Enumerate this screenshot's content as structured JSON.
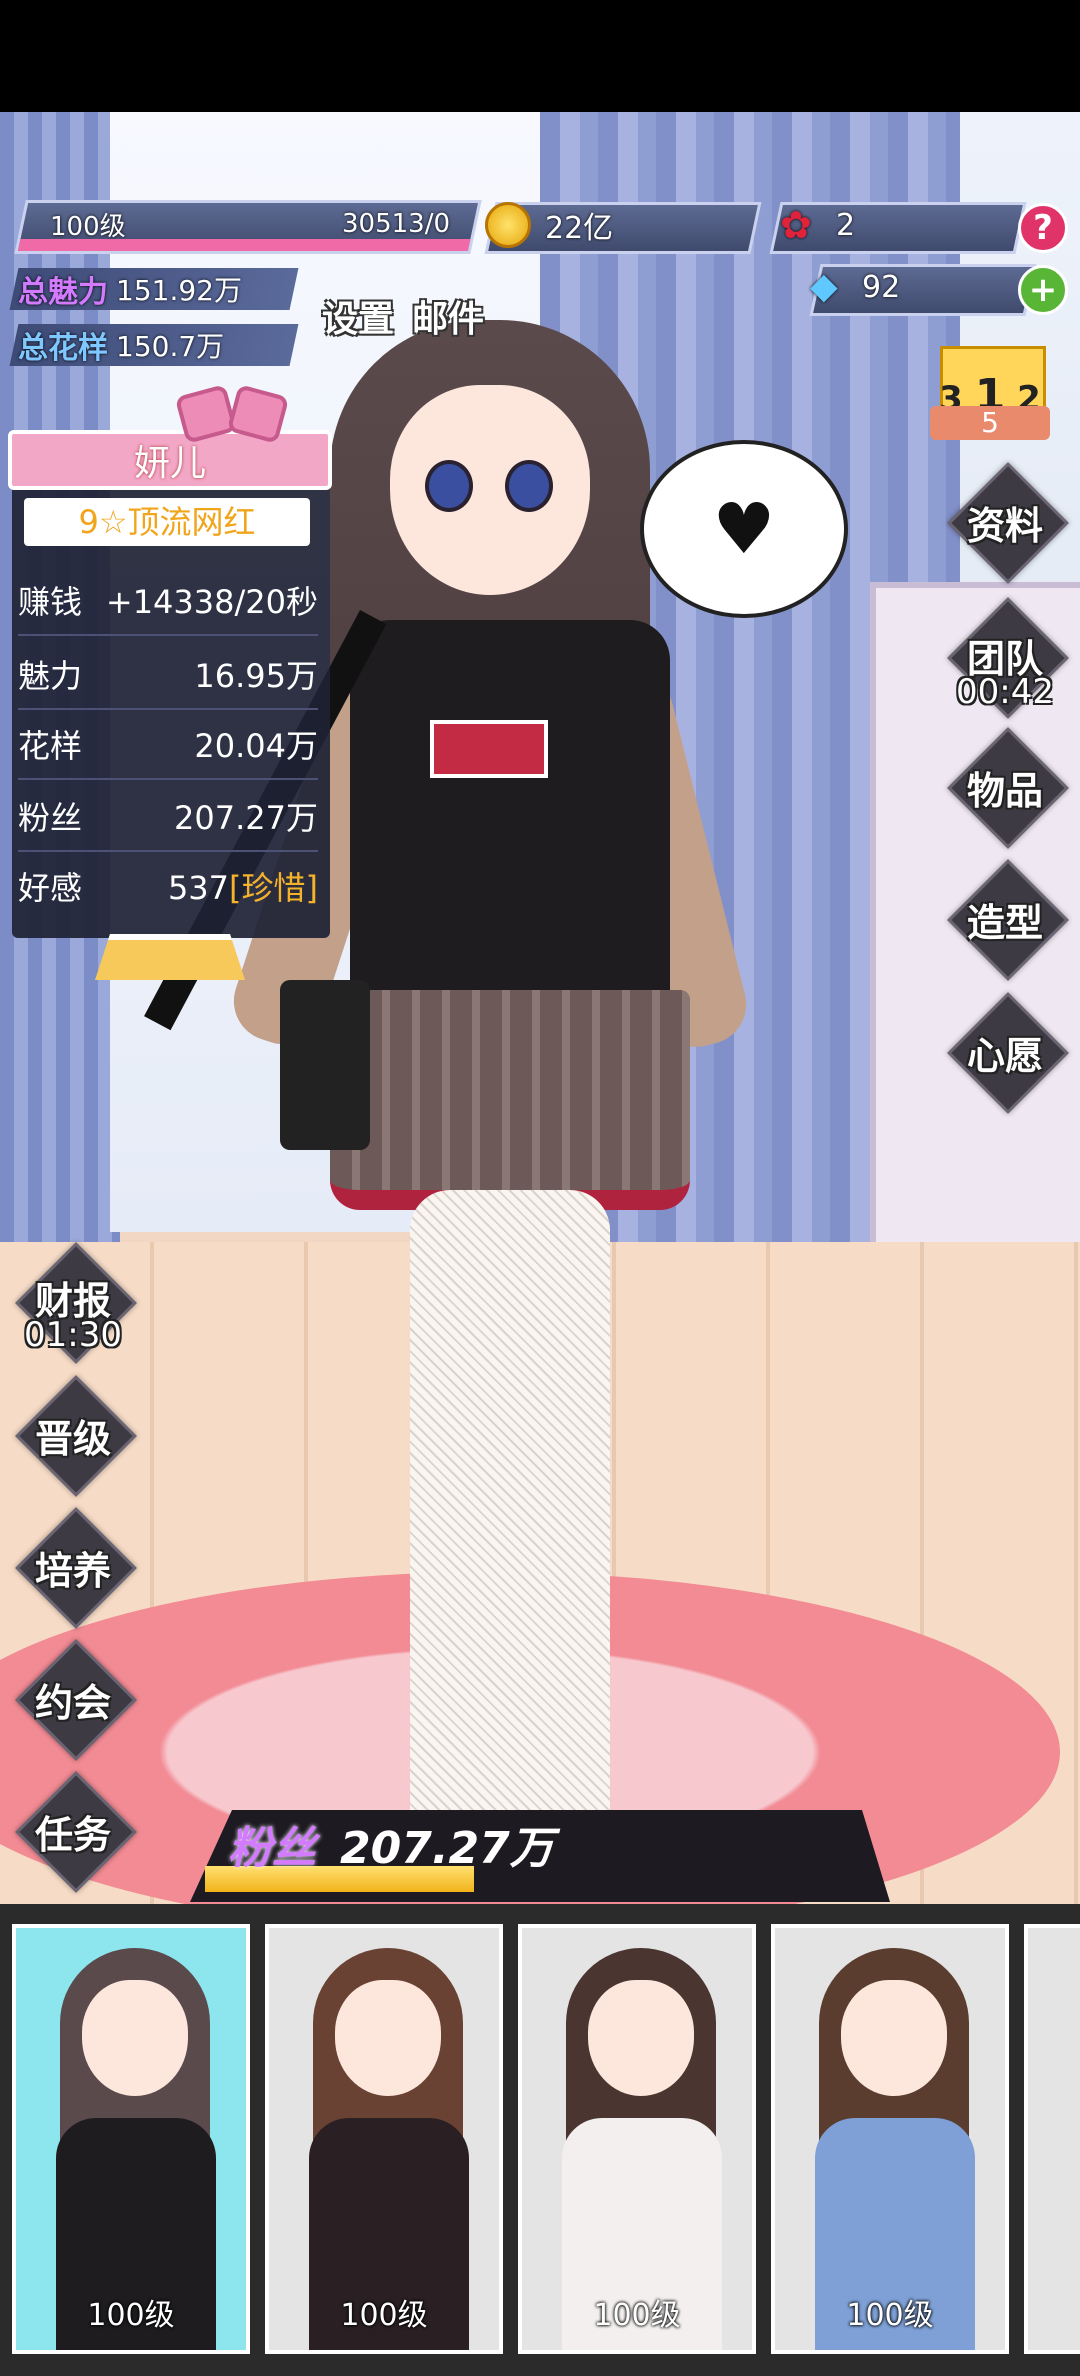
{
  "hud": {
    "level": "100级",
    "exp": "30513/0",
    "exp_fraction": 1.0,
    "coins": "22亿",
    "roses": "2",
    "gems": "92",
    "help_icon": "question-icon",
    "add_icon": "plus-icon"
  },
  "stats": {
    "charm_label": "总魅力",
    "charm_value": "151.92万",
    "style_label": "总花样",
    "style_value": "150.7万"
  },
  "top_links": {
    "settings": "设置",
    "mail": "邮件"
  },
  "ranking": {
    "places": [
      "3",
      "1",
      "2"
    ],
    "count": "5"
  },
  "girl": {
    "name": "妍儿",
    "title": "9☆顶流网红",
    "rows": [
      {
        "label": "赚钱",
        "value": "+14338/20秒"
      },
      {
        "label": "魅力",
        "value": "16.95万"
      },
      {
        "label": "花样",
        "value": "20.04万"
      },
      {
        "label": "粉丝",
        "value": "207.27万"
      }
    ],
    "affinity_label": "好感",
    "affinity_value": "537",
    "affinity_tag": "[珍惜]"
  },
  "right_menu": {
    "profile": "资料",
    "team": "团队",
    "team_timer": "00:42",
    "items": "物品",
    "styling": "造型",
    "wish": "心愿"
  },
  "left_menu": {
    "report": "财报",
    "report_timer": "01:30",
    "promote": "晋级",
    "train": "培养",
    "date": "约会",
    "tasks": "任务"
  },
  "fans_bar": {
    "label": "粉丝",
    "value": "207.27万",
    "fraction": 0.42
  },
  "roster": [
    {
      "level": "100级",
      "bg": "#8de5ee",
      "hair": "#5b4a4c",
      "outfit": "#1e1c1f"
    },
    {
      "level": "100级",
      "bg": "#e4e4e4",
      "hair": "#6a4233",
      "outfit": "#2a2024"
    },
    {
      "level": "100级",
      "bg": "#e4e4e4",
      "hair": "#4a3530",
      "outfit": "#f2efee"
    },
    {
      "level": "100级",
      "bg": "#e4e4e4",
      "hair": "#5a3d2f",
      "outfit": "#7ea0d6"
    }
  ],
  "colors": {
    "accent_pink": "#f06aa7",
    "gold": "#f5b22b",
    "panel": "#3f4a6d"
  }
}
